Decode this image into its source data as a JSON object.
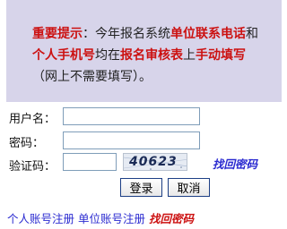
{
  "notice": {
    "line1": {
      "prefix": "重要提示",
      "colon": "：今年报名系统",
      "hl1": "单位联系电话",
      "suffix": "和"
    },
    "line2": {
      "hl1": "个人手机号",
      "mid1": "均在",
      "hl2": "报名审核表",
      "mid2": "上",
      "hl3": "手动填写"
    },
    "line3": "（网上不需要填写）。"
  },
  "login": {
    "username_label": "用户名：",
    "username_value": "",
    "password_label": "密码：",
    "password_value": "",
    "captcha_label": "验证码：",
    "captcha_value": "",
    "captcha_text": "40623",
    "forgot_link": "找回密码",
    "login_button": "登录",
    "cancel_button": "取消"
  },
  "footer": {
    "personal_register": "个人账号注册",
    "unit_register": "单位账号注册",
    "forgot_password": "找回密码"
  }
}
